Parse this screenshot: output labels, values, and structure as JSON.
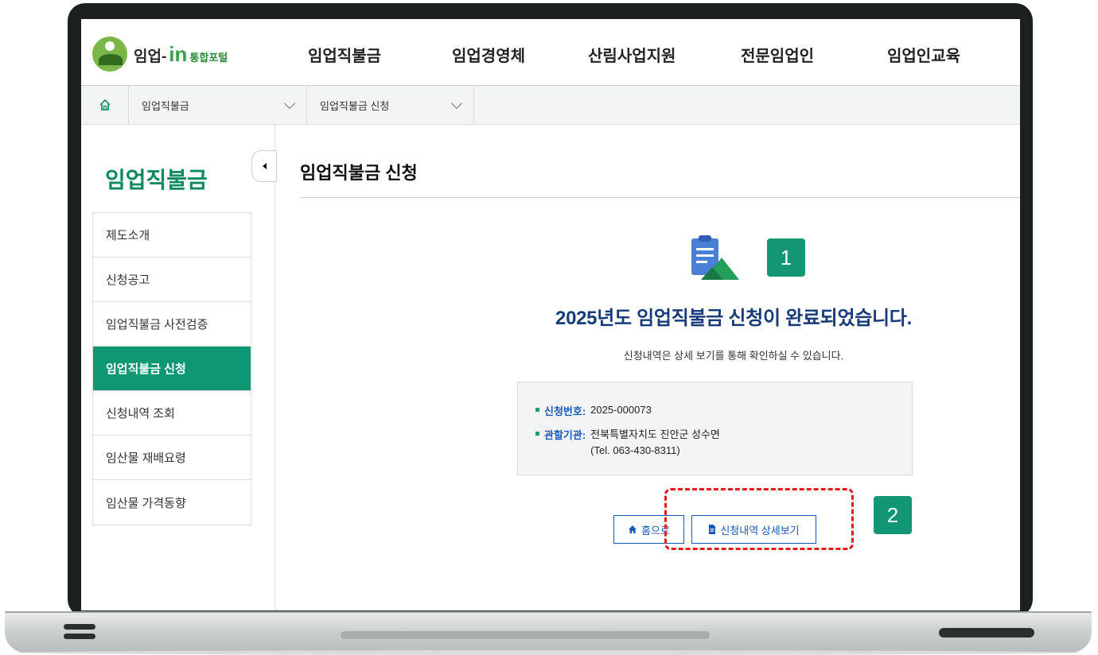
{
  "header": {
    "logo_prefix": "임업-",
    "logo_in": "in",
    "logo_suffix": "통합포털",
    "nav": [
      "임업직불금",
      "임업경영체",
      "산림사업지원",
      "전문임업인",
      "임업인교육"
    ]
  },
  "breadcrumb": {
    "home_icon": "home-icon",
    "level1": "임업직불금",
    "level2": "임업직불금 신청"
  },
  "sidebar": {
    "title": "임업직불금",
    "items": [
      {
        "label": "제도소개",
        "active": false
      },
      {
        "label": "신청공고",
        "active": false
      },
      {
        "label": "임업직불금 사전검증",
        "active": false
      },
      {
        "label": "임업직불금 신청",
        "active": true
      },
      {
        "label": "신청내역 조회",
        "active": false
      },
      {
        "label": "임산물 재배요령",
        "active": false
      },
      {
        "label": "임산물 가격동향",
        "active": false
      }
    ]
  },
  "main": {
    "page_title": "임업직불금 신청",
    "done_title": "2025년도 임업직불금 신청이 완료되었습니다.",
    "done_desc": "신청내역은 상세 보기를 통해 확인하실 수 있습니다.",
    "info": {
      "app_no_label": "신청번호:",
      "app_no_value": "2025-000073",
      "agency_label": "관할기관:",
      "agency_value": "전북특별자치도 진안군 성수면",
      "agency_tel": "(Tel. 063-430-8311)"
    },
    "home_button": "홈으로",
    "detail_button": "신청내역 상세보기"
  },
  "annotations": {
    "step1": "1",
    "step2": "2"
  },
  "colors": {
    "brand_green": "#0f9773",
    "title_blue": "#173a7a",
    "link_blue": "#1559b8",
    "highlight_red": "#e01e1e"
  }
}
